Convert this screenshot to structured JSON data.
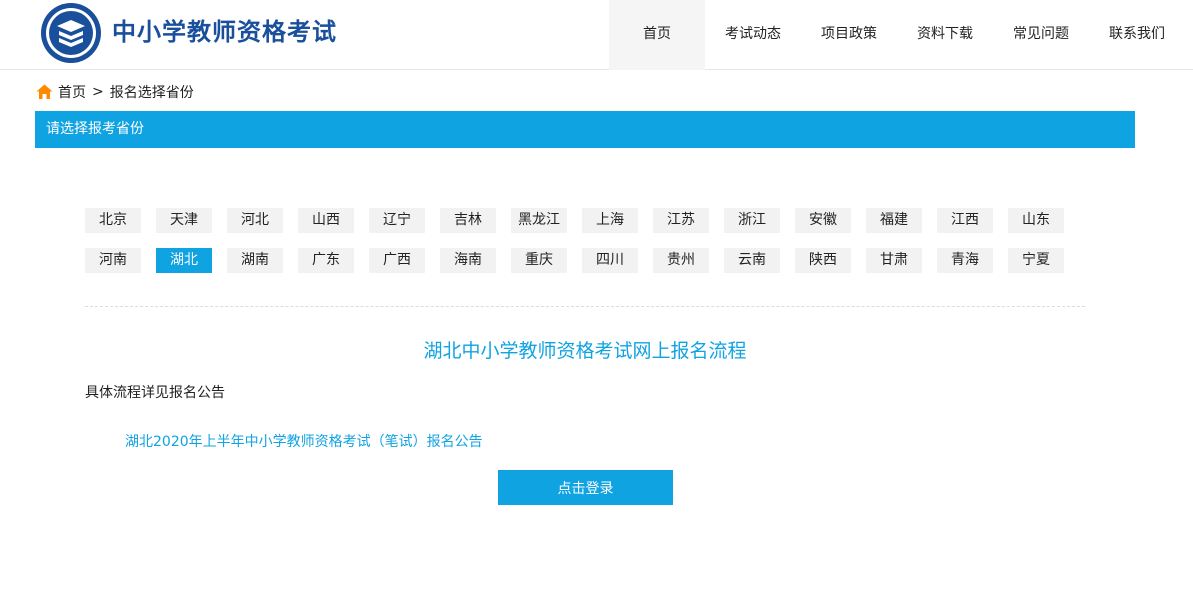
{
  "header": {
    "site_title": "中小学教师资格考试",
    "nav": [
      {
        "label": "首页",
        "active": true
      },
      {
        "label": "考试动态"
      },
      {
        "label": "项目政策"
      },
      {
        "label": "资料下载"
      },
      {
        "label": "常见问题"
      },
      {
        "label": "联系我们"
      }
    ]
  },
  "breadcrumb": {
    "home": "首页",
    "separator": ">",
    "current": "报名选择省份"
  },
  "section": {
    "title": "请选择报考省份"
  },
  "provinces": {
    "row1": [
      "北京",
      "天津",
      "河北",
      "山西",
      "辽宁",
      "吉林",
      "黑龙江",
      "上海",
      "江苏",
      "浙江",
      "安徽",
      "福建",
      "江西",
      "山东"
    ],
    "row2": [
      "河南",
      "湖北",
      "湖南",
      "广东",
      "广西",
      "海南",
      "重庆",
      "四川",
      "贵州",
      "云南",
      "陕西",
      "甘肃",
      "青海",
      "宁夏"
    ],
    "selected": "湖北"
  },
  "flow": {
    "title": "湖北中小学教师资格考试网上报名流程",
    "desc": "具体流程详见报名公告",
    "notice_link": "湖北2020年上半年中小学教师资格考试（笔试）报名公告",
    "login_button": "点击登录"
  },
  "colors": {
    "accent": "#10a3e2",
    "brand": "#1a4f9c",
    "home_icon": "#ff8a00"
  }
}
